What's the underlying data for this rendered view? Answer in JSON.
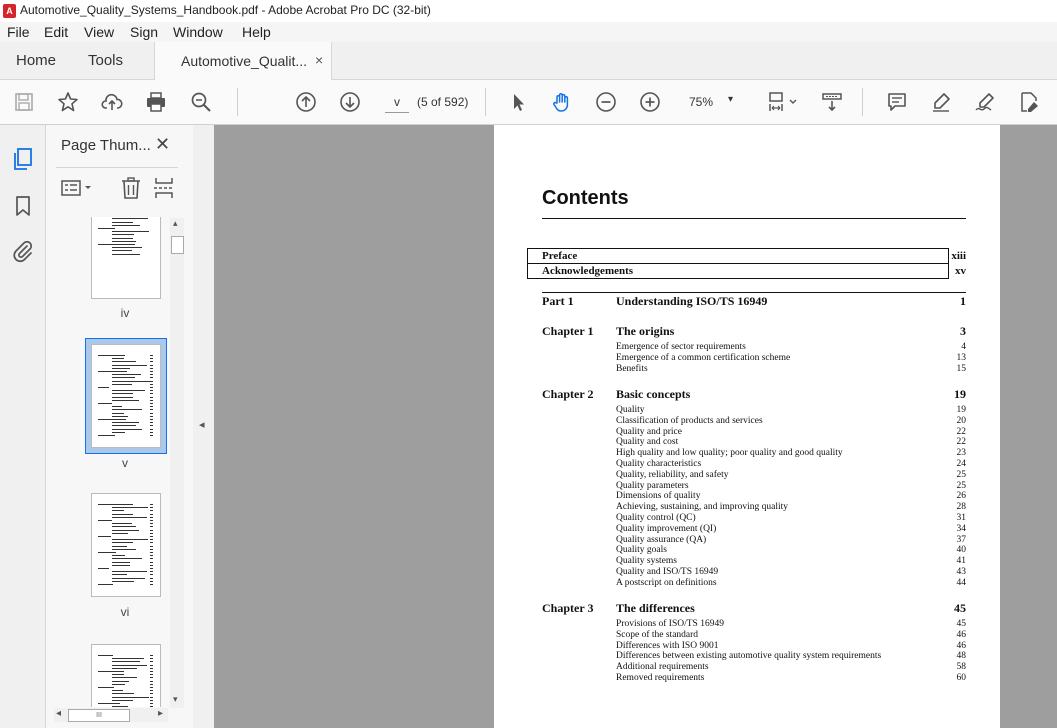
{
  "window": {
    "title": "Automotive_Quality_Systems_Handbook.pdf - Adobe Acrobat Pro DC (32-bit)",
    "logo_text": "A"
  },
  "menu": [
    "File",
    "Edit",
    "View",
    "Sign",
    "Window",
    "Help"
  ],
  "tabs": {
    "home": "Home",
    "tools": "Tools",
    "document": "Automotive_Qualit...",
    "close": "×"
  },
  "toolbar": {
    "page_input": "v",
    "page_count": "(5 of 592)",
    "zoom": "75%",
    "zoom_arrow": "▾"
  },
  "thumbnails": {
    "title": "Page Thum...",
    "close": "✕",
    "pages": [
      {
        "label": "iv",
        "selected": false
      },
      {
        "label": "v",
        "selected": true
      },
      {
        "label": "vi",
        "selected": false
      },
      {
        "label": "",
        "selected": false
      }
    ],
    "scroll_left": "◂",
    "scroll_right": "▸",
    "scroll_up": "▴",
    "scroll_down": "▾",
    "hscroll_grip": "III"
  },
  "splitter_arrow": "◂",
  "document": {
    "heading": "Contents",
    "front_matter": [
      {
        "title": "Preface",
        "page": "xiii"
      },
      {
        "title": "Acknowledgements",
        "page": "xv"
      }
    ],
    "part": {
      "label": "Part 1",
      "title": "Understanding ISO/TS 16949",
      "page": "1"
    },
    "chapters": [
      {
        "label": "Chapter 1",
        "title": "The origins",
        "page": "3",
        "items": [
          {
            "t": "Emergence of sector requirements",
            "p": "4"
          },
          {
            "t": "Emergence of a common certification scheme",
            "p": "13"
          },
          {
            "t": "Benefits",
            "p": "15"
          }
        ]
      },
      {
        "label": "Chapter 2",
        "title": "Basic concepts",
        "page": "19",
        "items": [
          {
            "t": "Quality",
            "p": "19"
          },
          {
            "t": "Classification of products and services",
            "p": "20"
          },
          {
            "t": "Quality and price",
            "p": "22"
          },
          {
            "t": "Quality and cost",
            "p": "22"
          },
          {
            "t": "High quality and low quality; poor quality and good quality",
            "p": "23"
          },
          {
            "t": "Quality characteristics",
            "p": "24"
          },
          {
            "t": "Quality, reliability, and safety",
            "p": "25"
          },
          {
            "t": "Quality parameters",
            "p": "25"
          },
          {
            "t": "Dimensions of quality",
            "p": "26"
          },
          {
            "t": "Achieving, sustaining, and improving quality",
            "p": "28"
          },
          {
            "t": "Quality control (QC)",
            "p": "31"
          },
          {
            "t": "Quality improvement (QI)",
            "p": "34"
          },
          {
            "t": "Quality assurance (QA)",
            "p": "37"
          },
          {
            "t": "Quality goals",
            "p": "40"
          },
          {
            "t": "Quality systems",
            "p": "41"
          },
          {
            "t": "Quality and ISO/TS 16949",
            "p": "43"
          },
          {
            "t": "A postscript on definitions",
            "p": "44"
          }
        ]
      },
      {
        "label": "Chapter 3",
        "title": "The differences",
        "page": "45",
        "items": [
          {
            "t": "Provisions of ISO/TS 16949",
            "p": "45"
          },
          {
            "t": "Scope of the standard",
            "p": "46"
          },
          {
            "t": "Differences with ISO 9001",
            "p": "46"
          },
          {
            "t": "Differences between existing automotive quality system requirements",
            "p": "48"
          },
          {
            "t": "Additional requirements",
            "p": "58"
          },
          {
            "t": "Removed requirements",
            "p": "60"
          }
        ]
      }
    ]
  },
  "colors": {
    "accent": "#1473e6",
    "doc_bg": "#9e9e9e",
    "pdf_red": "#d7232a"
  },
  "icons": [
    "save-icon",
    "star-icon",
    "upload-icon",
    "print-icon",
    "zoom-search-icon",
    "prev-page-icon",
    "next-page-icon",
    "select-arrow-icon",
    "hand-icon",
    "zoom-out-icon",
    "zoom-in-icon",
    "page-fit-icon",
    "scroll-mode-icon",
    "comment-icon",
    "highlight-icon",
    "sign-icon",
    "edit-icon"
  ]
}
